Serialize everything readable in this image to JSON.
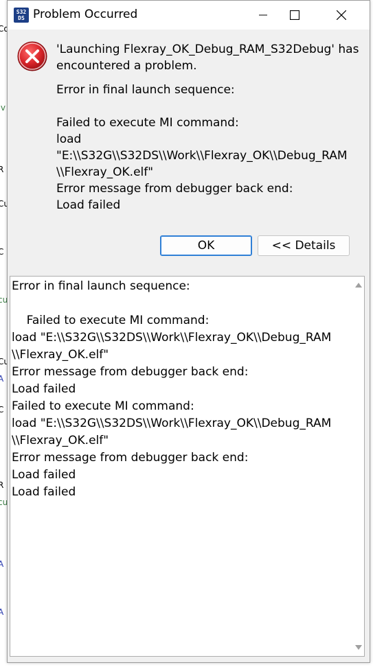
{
  "window": {
    "title": "Problem Occurred",
    "app_icon_text": "S32 DS"
  },
  "message": {
    "headline": "'Launching Flexray_OK_Debug_RAM_S32Debug' has\nencountered a problem.",
    "body": "Error in final launch sequence:\n\nFailed to execute MI command:\nload\n\"E:\\\\S32G\\\\S32DS\\\\Work\\\\Flexray_OK\\\\Debug_RAM\n\\\\Flexray_OK.elf\"\nError message from debugger back end:\nLoad failed"
  },
  "buttons": {
    "ok": "OK",
    "details": "<< Details"
  },
  "details": {
    "text": "Error in final launch sequence:\n\n    Failed to execute MI command:\nload \"E:\\\\S32G\\\\S32DS\\\\Work\\\\Flexray_OK\\\\Debug_RAM\n\\\\Flexray_OK.elf\"\nError message from debugger back end:\nLoad failed\nFailed to execute MI command:\nload \"E:\\\\S32G\\\\S32DS\\\\Work\\\\Flexray_OK\\\\Debug_RAM\n\\\\Flexray_OK.elf\"\nError message from debugger back end:\nLoad failed\nLoad failed"
  },
  "colors": {
    "accent": "#2f7fd6",
    "error_red": "#d9262b",
    "icon_bg": "#1d3f86"
  },
  "icons": [
    "app-logo-icon",
    "minimize-icon",
    "maximize-icon",
    "close-icon",
    "error-icon",
    "scroll-up-icon",
    "scroll-down-icon"
  ]
}
